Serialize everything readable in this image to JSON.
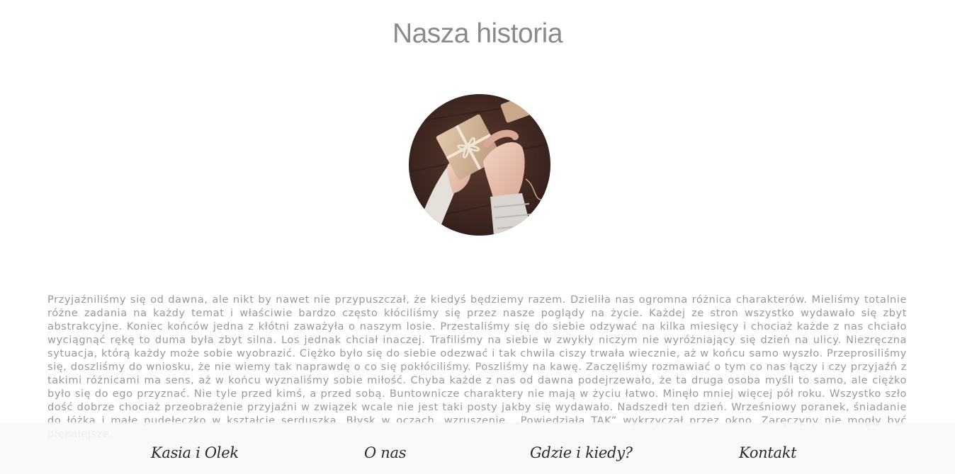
{
  "title": "Nasza historia",
  "photo": {
    "alt": "Dłonie trzymające małe pudełeczko owinięte papierem i sznurkiem"
  },
  "story": "Przyjaźniliśmy się od dawna, ale nikt by nawet nie przypuszczał, że kiedyś będziemy razem. Dzieliła nas ogromna różnica charakterów. Mieliśmy totalnie różne zadania na każdy temat i właściwie bardzo często kłóciliśmy się przez nasze poglądy na życie. Każdej ze stron wszystko wydawało się zbyt abstrakcyjne. Koniec końców jedna z kłótni zaważyła o naszym losie. Przestaliśmy się do siebie odzywać na kilka miesięcy i chociaż każde z nas chciało wyciągnąć rękę to duma była zbyt silna. Los jednak chciał inaczej. Trafiliśmy na siebie w zwykły niczym nie wyróżniający się dzień na ulicy. Niezręczna sytuacja, którą każdy może sobie wyobrazić. Ciężko było się do siebie odezwać i tak chwila ciszy trwała wiecznie, aż w końcu samo wyszło. Przeprosiliśmy się, doszliśmy do wniosku, że nie wiemy tak naprawdę o co się pokłóciliśmy. Poszliśmy na kawę. Zaczęliśmy rozmawiać o tym co nas łączy i czy przyjaźń z takimi różnicami ma sens, aż w końcu wyznaliśmy sobie miłość. Chyba każde z nas od dawna podejrzewało, że ta druga osoba myśli to samo, ale ciężko było się do ego przyznać. Nie tyle przed kimś, a przed sobą. Buntownicze charaktery nie mają w życiu łatwo. Minęło mniej więcej pół roku. Wszystko szło dość dobrze chociaż przeobrażenie przyjaźni w związek wcale nie jest taki posty jakby się wydawało. Nadszedł ten dzień. Wrześniowy poranek, śniadanie do łóżka i małe pudełeczko w kształcie serduszka. Błysk w oczach, wzruszenie, „Powiedziała TAK” wykrzyczał przez okno. Zaręczyny nie mogły być piękniejsze.",
  "nav": {
    "home": "Kasia i Olek",
    "about": "O nas",
    "where_when": "Gdzie i kiedy?",
    "contact": "Kontakt"
  }
}
